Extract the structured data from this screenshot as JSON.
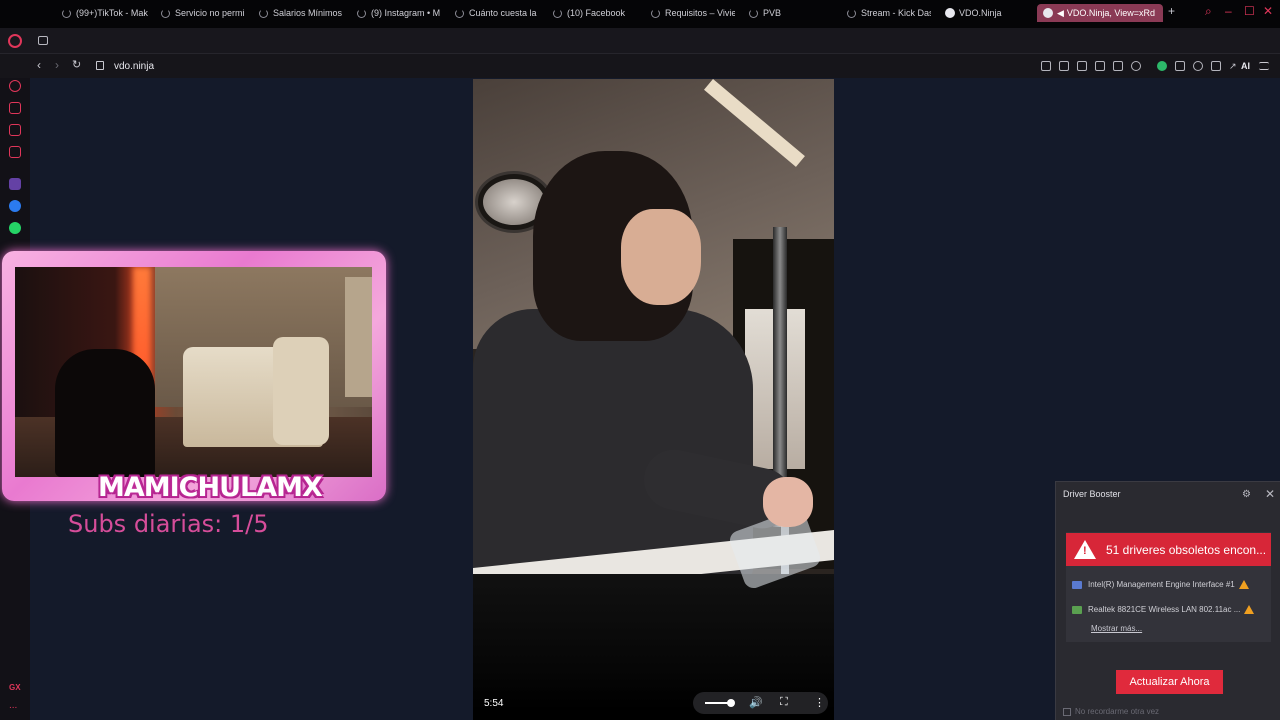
{
  "browser": {
    "tabs": [
      {
        "label": "(99+)TikTok - Mak"
      },
      {
        "label": "Servicio no permi"
      },
      {
        "label": "Salarios Mínimos ·"
      },
      {
        "label": "(9) Instagram • M"
      },
      {
        "label": "Cuánto cuesta la ·"
      },
      {
        "label": "(10) Facebook"
      },
      {
        "label": "Requisitos – Vivie"
      },
      {
        "label": "PVB"
      },
      {
        "label": "Stream - Kick Das"
      },
      {
        "label": "VDO.Ninja"
      },
      {
        "label": "VDO.Ninja, View=xRd"
      }
    ],
    "new_tab": "+",
    "url": "vdo.ninja",
    "ai_label": "AI",
    "accent": "#e0365a"
  },
  "sidebar": {
    "gx_label": "GX",
    "more_label": "..."
  },
  "overlay": {
    "streamer_name": "MAMICHULAMX",
    "subs_text": "Subs diarias: 1/5"
  },
  "video": {
    "time": "5:54",
    "volume_level": 0.85
  },
  "driver_booster": {
    "title": "Driver Booster",
    "alert": "51 driveres obsoletos encon...",
    "items": [
      {
        "label": "Intel(R) Management Engine Interface #1"
      },
      {
        "label": "Realtek 8821CE Wireless LAN 802.11ac ..."
      }
    ],
    "more_link": "Mostrar más...",
    "update_button": "Actualizar Ahora",
    "dont_remind": "No recordarme otra vez"
  }
}
